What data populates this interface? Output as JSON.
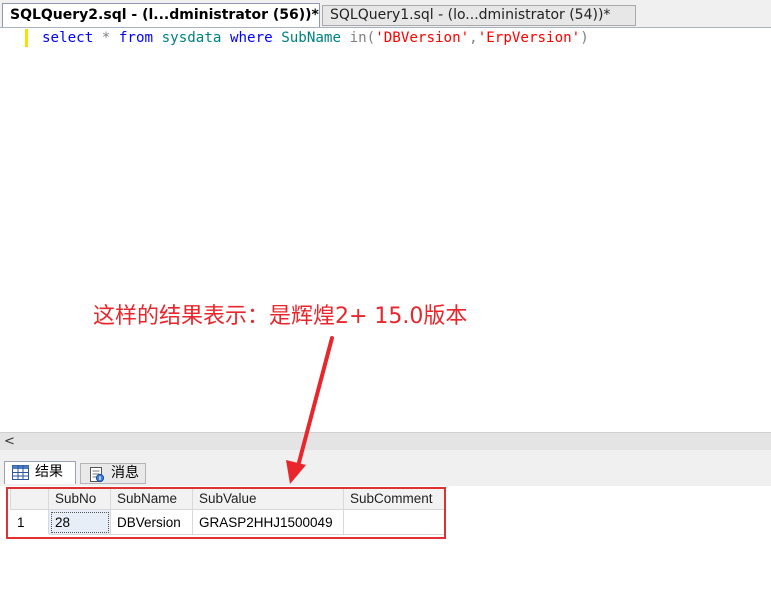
{
  "tabs": [
    {
      "label": "SQLQuery2.sql - (l...dministrator (56))*",
      "active": true
    },
    {
      "label": "SQLQuery1.sql - (lo...dministrator (54))*",
      "active": false
    }
  ],
  "editor": {
    "kw_select": "select",
    "op_star": "*",
    "kw_from": "from",
    "table": "sysdata",
    "kw_where": "where",
    "column": "SubName",
    "kw_in": "in",
    "paren_open": "(",
    "str1": "'DBVersion'",
    "comma": ",",
    "str2": "'ErpVersion'",
    "paren_close": ")"
  },
  "scrollbar": {
    "left_arrow": "<"
  },
  "results_tabs": [
    {
      "label": "结果",
      "icon": "grid-icon"
    },
    {
      "label": "消息",
      "icon": "message-icon"
    }
  ],
  "grid": {
    "columns": [
      "SubNo",
      "SubName",
      "SubValue",
      "SubComment"
    ],
    "rows": [
      {
        "rownum": "1",
        "cells": [
          "28",
          "DBVersion",
          "GRASP2HHJ1500049",
          ""
        ]
      }
    ]
  },
  "annotation": {
    "text": "这样的结果表示：是辉煌2+ 15.0版本",
    "color": "#e8262b"
  }
}
